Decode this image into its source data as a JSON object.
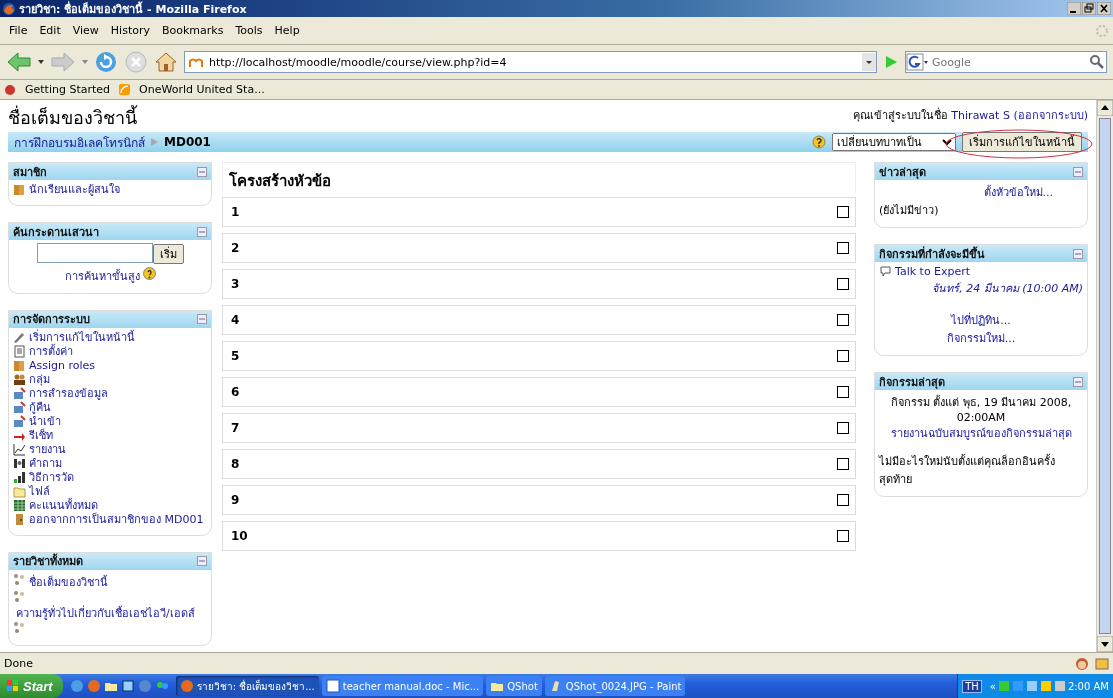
{
  "window": {
    "title": "รายวิชา: ชื่อเต็มของวิชานี้ - Mozilla Firefox"
  },
  "menu": [
    "File",
    "Edit",
    "View",
    "History",
    "Bookmarks",
    "Tools",
    "Help"
  ],
  "address_bar": {
    "value": "http://localhost/moodle/moodle/course/view.php?id=4"
  },
  "search_bar": {
    "placeholder": "Google"
  },
  "bookmarks": [
    "Getting Started",
    "OneWorld United Sta..."
  ],
  "page": {
    "course_title": "ชื่อเต็มของวิชานี้",
    "login_text": "คุณเข้าสู่ระบบในชื่อ",
    "user": "Thirawat S",
    "logout": "(ออกจากระบบ)",
    "breadcrumb": [
      "การฝึกอบรมอิเลคโทรนิกส์",
      "MD001"
    ],
    "role_select": {
      "value": "เปลี่ยนบทบาทเป็น"
    },
    "edit_button": "เริ่มการแก้ไขในหน้านี้"
  },
  "left_blocks": [
    {
      "kind": "links",
      "title": "สมาชิก",
      "items": [
        "นักเรียนและผู้สนใจ"
      ]
    },
    {
      "kind": "search",
      "title": "ค้นกระดานเสวนา",
      "button": "เริ่ม",
      "link": "การค้นหาขั้นสูง"
    },
    {
      "kind": "links",
      "title": "การจัดการระบบ",
      "items": [
        "เริ่มการแก้ไขในหน้านี้",
        "การตั้งค่า",
        "Assign roles",
        "กลุ่ม",
        "การสำรองข้อมูล",
        "กู้คืน",
        "นำเข้า",
        "รีเซ็ท",
        "รายงาน",
        "คำถาม",
        "วิธีการวัด",
        "ไฟล์",
        "คะแนนทั้งหมด",
        "ออกจากการเป็นสมาชิกของ MD001"
      ]
    },
    {
      "kind": "courses",
      "title": "รายวิชาทั้งหมด",
      "items": [
        "ชื่อเต็มของวิชานี้",
        "ความรู้ทั่วไปเกี่ยวกับเชื้อเอชไอวี/เอดส์"
      ]
    }
  ],
  "topics": {
    "title": "โครงสร้างหัวข้อ",
    "sections": [
      {
        "label": "1",
        "checked": false
      },
      {
        "label": "2",
        "checked": false
      },
      {
        "label": "3",
        "checked": false
      },
      {
        "label": "4",
        "checked": false
      },
      {
        "label": "5",
        "checked": false
      },
      {
        "label": "6",
        "checked": false
      },
      {
        "label": "7",
        "checked": false
      },
      {
        "label": "8",
        "checked": false
      },
      {
        "label": "9",
        "checked": false
      },
      {
        "label": "10",
        "checked": false
      }
    ]
  },
  "right_blocks": [
    {
      "kind": "news",
      "title": "ข่าวล่าสุด",
      "link": "ตั้งหัวข้อใหม่...",
      "note": "(ยังไม่มีข่าว)"
    },
    {
      "kind": "events",
      "title": "กิจกรรมที่กำลังจะมีขึ้น",
      "event": "Talk to Expert",
      "date": "จันทร์, 24 มีนาคม (10:00 AM)",
      "links": [
        "ไปที่ปฏิทิน...",
        "กิจกรรมใหม่..."
      ]
    },
    {
      "kind": "activity",
      "title": "กิจกรรมล่าสุด",
      "since": "กิจกรรม ตั้งแต่ พุธ, 19 มีนาคม 2008, 02:00AM",
      "link": "รายงานฉบับสมบูรณ์ของกิจกรรมล่าสุด",
      "note": "ไม่มีอะไรใหม่นับตั้งแต่คุณล็อกอินครั้งสุดท้าย"
    }
  ],
  "status_bar": {
    "text": "Done"
  },
  "taskbar": {
    "start": "Start",
    "tasks": [
      {
        "label": "รายวิชา: ชื่อเต็มของวิชา...",
        "selected": true
      },
      {
        "label": "teacher manual.doc - Mic...",
        "selected": false
      },
      {
        "label": "QShot",
        "selected": false
      },
      {
        "label": "QShot_0024.JPG - Paint",
        "selected": false
      }
    ],
    "language": "TH",
    "tray_expand": "«",
    "clock": "2:00 AM"
  }
}
